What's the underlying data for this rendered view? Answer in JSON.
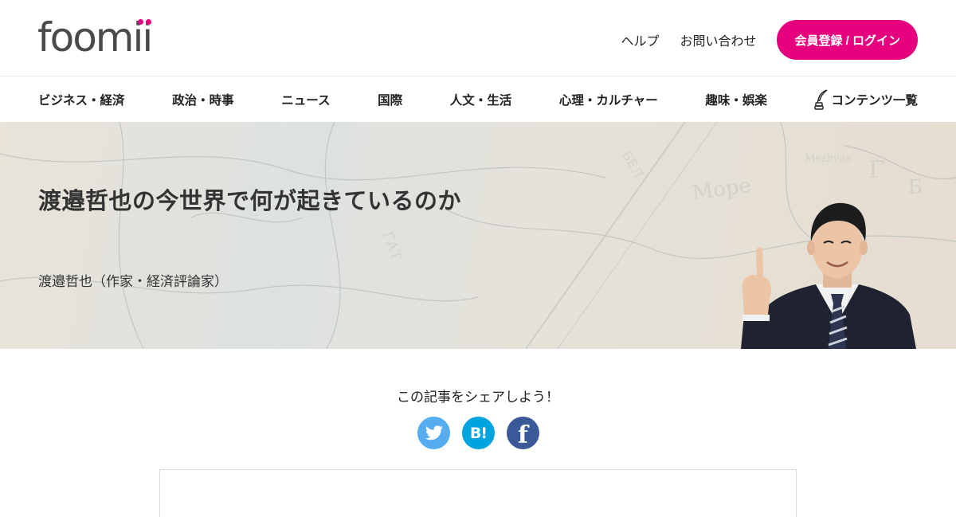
{
  "brand": {
    "logo_text": "foomii",
    "accent": "#e6007e"
  },
  "header": {
    "links": [
      {
        "label": "ヘルプ"
      },
      {
        "label": "お問い合わせ"
      }
    ],
    "login_button": "会員登録 / ログイン"
  },
  "nav": {
    "items": [
      {
        "label": "ビジネス・経済"
      },
      {
        "label": "政治・時事"
      },
      {
        "label": "ニュース"
      },
      {
        "label": "国際"
      },
      {
        "label": "人文・生活"
      },
      {
        "label": "心理・カルチャー"
      },
      {
        "label": "趣味・娯楽"
      },
      {
        "label": "コンテンツ一覧",
        "icon": "quill-pen-icon"
      }
    ]
  },
  "hero": {
    "title": "渡邉哲也の今世界で何が起きているのか",
    "author": "渡邉哲也（作家・経済評論家）"
  },
  "share": {
    "title": "この記事をシェアしよう！",
    "buttons": [
      {
        "name": "twitter",
        "icon": "twitter-bird-icon",
        "color": "#55acee"
      },
      {
        "name": "hatena",
        "label": "B!",
        "color": "#00a4de"
      },
      {
        "name": "facebook",
        "label": "f",
        "color": "#3b5998"
      }
    ]
  }
}
